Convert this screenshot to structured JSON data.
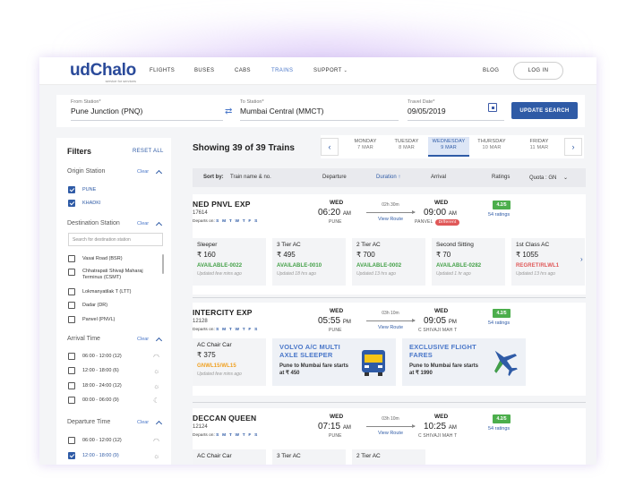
{
  "nav": {
    "logo": "udChalo",
    "tagline": "service for services",
    "links": [
      "FLIGHTS",
      "BUSES",
      "CABS",
      "TRAINS",
      "SUPPORT"
    ],
    "active": "TRAINS",
    "blog": "BLOG",
    "login": "LOG IN"
  },
  "search": {
    "from_label": "From Station*",
    "from_value": "Pune Junction (PNQ)",
    "to_label": "To Station*",
    "to_value": "Mumbai Central (MMCT)",
    "date_label": "Travel Date*",
    "date_value": "09/05/2019",
    "button": "UPDATE SEARCH"
  },
  "filters": {
    "title": "Filters",
    "reset": "RESET ALL",
    "origin": {
      "title": "Origin Station",
      "clear": "Clear",
      "options": [
        {
          "label": "PUNE",
          "checked": true
        },
        {
          "label": "KHADKI",
          "checked": true
        }
      ]
    },
    "destination": {
      "title": "Destination Station",
      "clear": "Clear",
      "search_placeholder": "Search for destination station",
      "options": [
        {
          "label": "Vasai Road (BSR)",
          "checked": false
        },
        {
          "label": "Chhatrapati Shivaji Maharaj Terminus (CSMT)",
          "checked": false
        },
        {
          "label": "Lokmanyatilak T (LTT)",
          "checked": false
        },
        {
          "label": "Dadar (DR)",
          "checked": false
        },
        {
          "label": "Panvel  (PNVL)",
          "checked": false
        }
      ]
    },
    "arrival": {
      "title": "Arrival Time",
      "clear": "Clear",
      "options": [
        {
          "label": "06:00 - 12:00 (12)",
          "icon": "sunrise-icon",
          "checked": false
        },
        {
          "label": "12:00 - 18:00 (6)",
          "icon": "sun-icon",
          "checked": false
        },
        {
          "label": "18:00 - 24:00 (12)",
          "icon": "sunset-icon",
          "checked": false
        },
        {
          "label": "00:00 - 06:00 (9)",
          "icon": "moon-icon",
          "checked": false
        }
      ]
    },
    "departure": {
      "title": "Departure Time",
      "clear": "Clear",
      "options": [
        {
          "label": "06:00 - 12:00 (12)",
          "icon": "sunrise-icon",
          "checked": false
        },
        {
          "label": "12:00 - 18:00 (9)",
          "icon": "sun-icon",
          "checked": true
        }
      ]
    }
  },
  "results": {
    "showing": "Showing 39 of 39 Trains",
    "dates": [
      {
        "day": "MONDAY",
        "date": "7 MAR",
        "selected": false
      },
      {
        "day": "TUESDAY",
        "date": "8 MAR",
        "selected": false
      },
      {
        "day": "WEDNESDAY",
        "date": "9 MAR",
        "selected": true
      },
      {
        "day": "THURSDAY",
        "date": "10 MAR",
        "selected": false
      },
      {
        "day": "FRIDAY",
        "date": "11 MAR",
        "selected": false
      }
    ],
    "sort": {
      "label": "Sort by:",
      "name": "Train name & no.",
      "departure": "Departure",
      "duration": "Duration ↑",
      "arrival": "Arrival",
      "ratings": "Ratings",
      "quota": "Quota : GN"
    }
  },
  "trains": [
    {
      "name": "NED PNVL EXP",
      "number": "17614",
      "departs_on": "Departs on:",
      "days": "S M T W T F S",
      "dep_day": "WED",
      "dep_time": "06:20",
      "dep_ampm": "AM",
      "dep_station": "PUNE",
      "duration": "02h 30m",
      "view_route": "View Route",
      "arr_day": "WED",
      "arr_time": "09:00",
      "arr_ampm": "AM",
      "arr_station": "PANVEL",
      "different": "Different",
      "rating": "4.2/5",
      "ratings_count": "54 ratings",
      "classes": [
        {
          "name": "Sleeper",
          "price": "₹ 160",
          "avail": "AVAILABLE-0022",
          "status": "green",
          "updated": "Updated few mins ago"
        },
        {
          "name": "3 Tier AC",
          "price": "₹ 495",
          "avail": "AVAILABLE-0010",
          "status": "green",
          "updated": "Updated 18 hrs ago"
        },
        {
          "name": "2 Tier AC",
          "price": "₹ 700",
          "avail": "AVAILABLE-0002",
          "status": "green",
          "updated": "Updated 13 hrs ago"
        },
        {
          "name": "Second Sitting",
          "price": "₹ 70",
          "avail": "AVAILABLE-0282",
          "status": "green",
          "updated": "Updated 1 hr ago"
        },
        {
          "name": "1st Class AC",
          "price": "₹ 1055",
          "avail": "REGRET/RLWL1",
          "status": "red",
          "updated": "Updated 13 hrs ago"
        }
      ]
    },
    {
      "name": "INTERCITY EXP",
      "number": "12128",
      "departs_on": "Departs on:",
      "days": "S M T W T F S",
      "dep_day": "WED",
      "dep_time": "05:55",
      "dep_ampm": "PM",
      "dep_station": "PUNE",
      "duration": "03h 10m",
      "view_route": "View Route",
      "arr_day": "WED",
      "arr_time": "09:05",
      "arr_ampm": "PM",
      "arr_station": "C SHIVAJI MAH T",
      "rating": "4.2/5",
      "ratings_count": "54 ratings",
      "classes": [
        {
          "name": "AC Chair Car",
          "price": "₹ 375",
          "avail": "GNWL15/WL15",
          "status": "orange",
          "updated": "Updated few mins ago"
        }
      ],
      "promos": [
        {
          "title": "VOLVO A/C MULTI AXLE SLEEPER",
          "sub": "Pune to Mumbai fare starts at ₹ 450",
          "icon": "bus-icon"
        },
        {
          "title": "EXCLUSIVE FLIGHT FARES",
          "sub": "Pune to Mumbai fare starts at ₹ 1990",
          "icon": "airplane-icon"
        }
      ]
    },
    {
      "name": "DECCAN QUEEN",
      "number": "12124",
      "departs_on": "Departs on:",
      "days": "S M T W T F S",
      "dep_day": "WED",
      "dep_time": "07:15",
      "dep_ampm": "AM",
      "dep_station": "PUNE",
      "duration": "03h 10m",
      "view_route": "View Route",
      "arr_day": "WED",
      "arr_time": "10:25",
      "arr_ampm": "AM",
      "arr_station": "C SHIVAJI MAH T",
      "rating": "4.2/5",
      "ratings_count": "54 ratings",
      "classes": [
        {
          "name": "AC Chair Car"
        },
        {
          "name": "3 Tier AC"
        },
        {
          "name": "2 Tier AC"
        }
      ]
    }
  ],
  "colors": {
    "brand": "#2a4a9a",
    "accent": "#2f5ba6",
    "available": "#43a047",
    "regret": "#e05858",
    "waitlist": "#f0a020",
    "rating": "#4cae4c"
  }
}
